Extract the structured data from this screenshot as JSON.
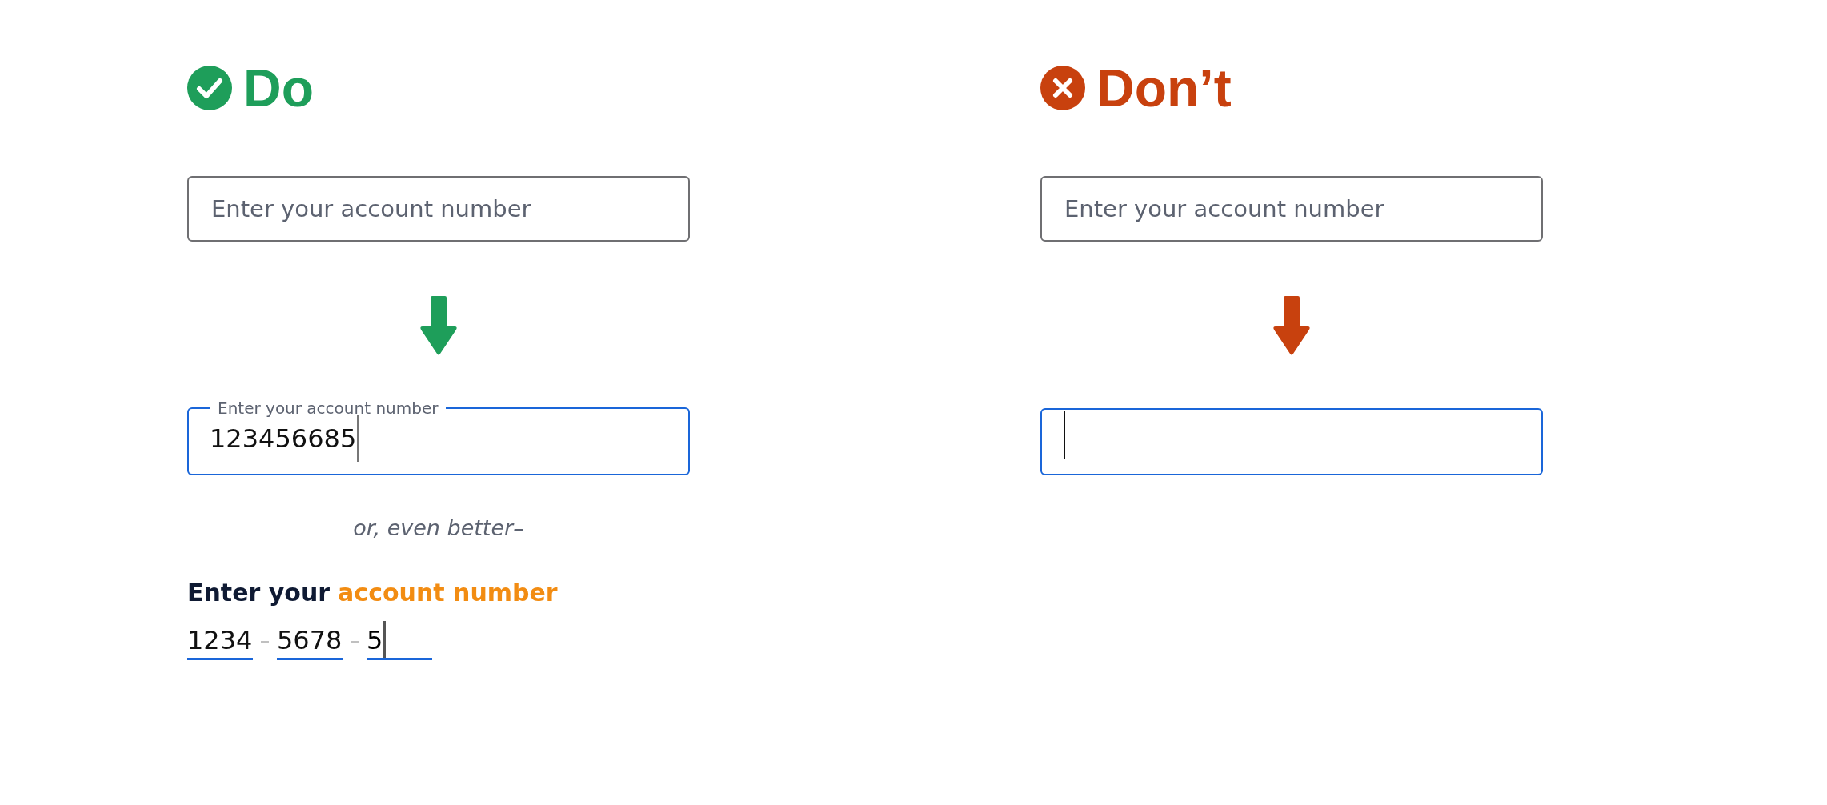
{
  "columns": [
    {
      "kind": "do",
      "heading": "Do",
      "color": "#1e9e5a",
      "before_field": {
        "placeholder": "Enter your account number"
      },
      "after_field": {
        "label": "Enter your account number",
        "value": "123456685",
        "focused": true
      },
      "alternative": {
        "note": "or, even better–",
        "title_lead": "Enter your",
        "title_highlight": "account number",
        "segments": [
          {
            "value": "1234",
            "focused": false
          },
          {
            "value": "5678",
            "focused": false
          },
          {
            "value": "5",
            "focused": true
          }
        ]
      }
    },
    {
      "kind": "dont",
      "heading": "Don’t",
      "color": "#c8410e",
      "before_field": {
        "placeholder": "Enter your account number"
      },
      "after_field": {
        "focused": true
      }
    }
  ]
}
